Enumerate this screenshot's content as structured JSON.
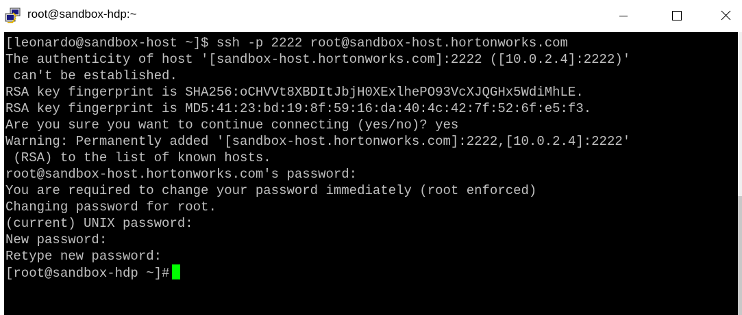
{
  "window": {
    "title": "root@sandbox-hdp:~",
    "icon": "putty-terminal-icon"
  },
  "controls": {
    "minimize": "minimize-icon",
    "maximize": "maximize-icon",
    "close": "close-icon"
  },
  "colors": {
    "terminal_bg": "#000000",
    "terminal_fg": "#c0c0c0",
    "cursor": "#00ff00"
  },
  "terminal": {
    "lines": [
      "[leonardo@sandbox-host ~]$ ssh -p 2222 root@sandbox-host.hortonworks.com",
      "The authenticity of host '[sandbox-host.hortonworks.com]:2222 ([10.0.2.4]:2222)'",
      " can't be established.",
      "RSA key fingerprint is SHA256:oCHVVt8XBDItJbjH0XExlhePO93VcXJQGHx5WdiMhLE.",
      "RSA key fingerprint is MD5:41:23:bd:19:8f:59:16:da:40:4c:42:7f:52:6f:e5:f3.",
      "Are you sure you want to continue connecting (yes/no)? yes",
      "Warning: Permanently added '[sandbox-host.hortonworks.com]:2222,[10.0.2.4]:2222'",
      " (RSA) to the list of known hosts.",
      "root@sandbox-host.hortonworks.com's password:",
      "You are required to change your password immediately (root enforced)",
      "Changing password for root.",
      "(current) UNIX password:",
      "New password:",
      "Retype new password:"
    ],
    "prompt": "[root@sandbox-hdp ~]#"
  }
}
